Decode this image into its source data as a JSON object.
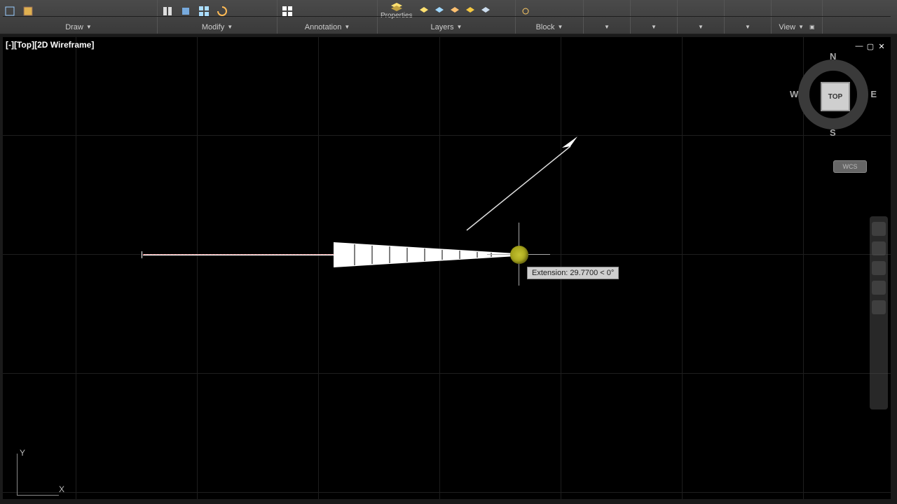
{
  "ribbon": {
    "panels": {
      "draw": {
        "title": "Draw"
      },
      "modify": {
        "title": "Modify"
      },
      "annotation": {
        "title": "Annotation"
      },
      "layers": {
        "title": "Layers",
        "lead_label": "Properties"
      },
      "block": {
        "title": "Block"
      },
      "view": {
        "title": "View"
      }
    },
    "small_panels": [
      "",
      "",
      "",
      ""
    ]
  },
  "viewport": {
    "label": "[-][Top][2D Wireframe]"
  },
  "viewcube": {
    "face": "TOP",
    "n": "N",
    "s": "S",
    "e": "E",
    "w": "W",
    "coord_label": "WCS"
  },
  "cursor_tooltip": "Extension: 29.7700 < 0°",
  "ucs": {
    "x": "X",
    "y": "Y"
  }
}
